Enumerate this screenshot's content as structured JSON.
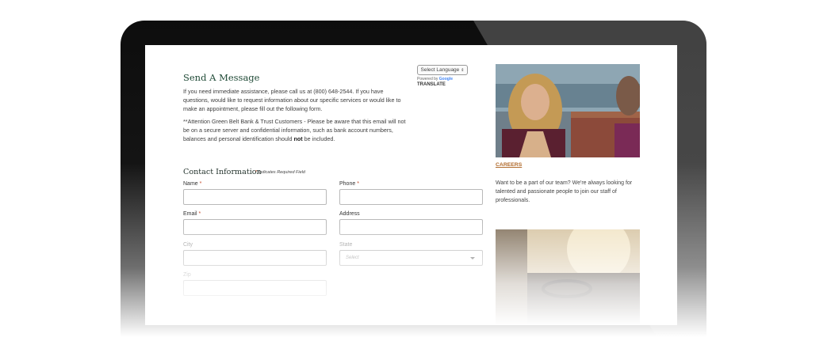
{
  "header": {
    "title": "Send A Message",
    "intro": "If you need immediate assistance, please call us at (800) 648-2544. If you have questions, would like to request information about our specific services or would like to make an appointment, please fill out the following form.",
    "attention_before": "**Attention Green Belt Bank & Trust Customers - Please be aware that this email will not be on a secure server and confidential information, such as bank account numbers, balances and personal identification should ",
    "attention_bold": "not",
    "attention_after": " be included."
  },
  "translate": {
    "select_label": "Select Language",
    "powered_by": "Powered by",
    "google": "Google",
    "link": "TRANSLATE"
  },
  "form": {
    "section_title": "Contact Information",
    "required_note": "Indicates Required Field",
    "star": "*",
    "fields": {
      "name": {
        "label": "Name",
        "value": ""
      },
      "phone": {
        "label": "Phone",
        "value": ""
      },
      "email": {
        "label": "Email",
        "value": ""
      },
      "address": {
        "label": "Address",
        "value": ""
      },
      "city": {
        "label": "City",
        "value": ""
      },
      "state": {
        "label": "State",
        "selected": "Select"
      },
      "zip": {
        "label": "Zip",
        "value": ""
      }
    }
  },
  "sidebar": {
    "careers_link": "CAREERS",
    "careers_text": "Want to be a part of our team? We're always looking for talented and passionate people to join our staff of professionals."
  },
  "colors": {
    "heading_green": "#1f4a36",
    "accent_orange": "#b06a2b",
    "required_red": "#c44a2a"
  }
}
